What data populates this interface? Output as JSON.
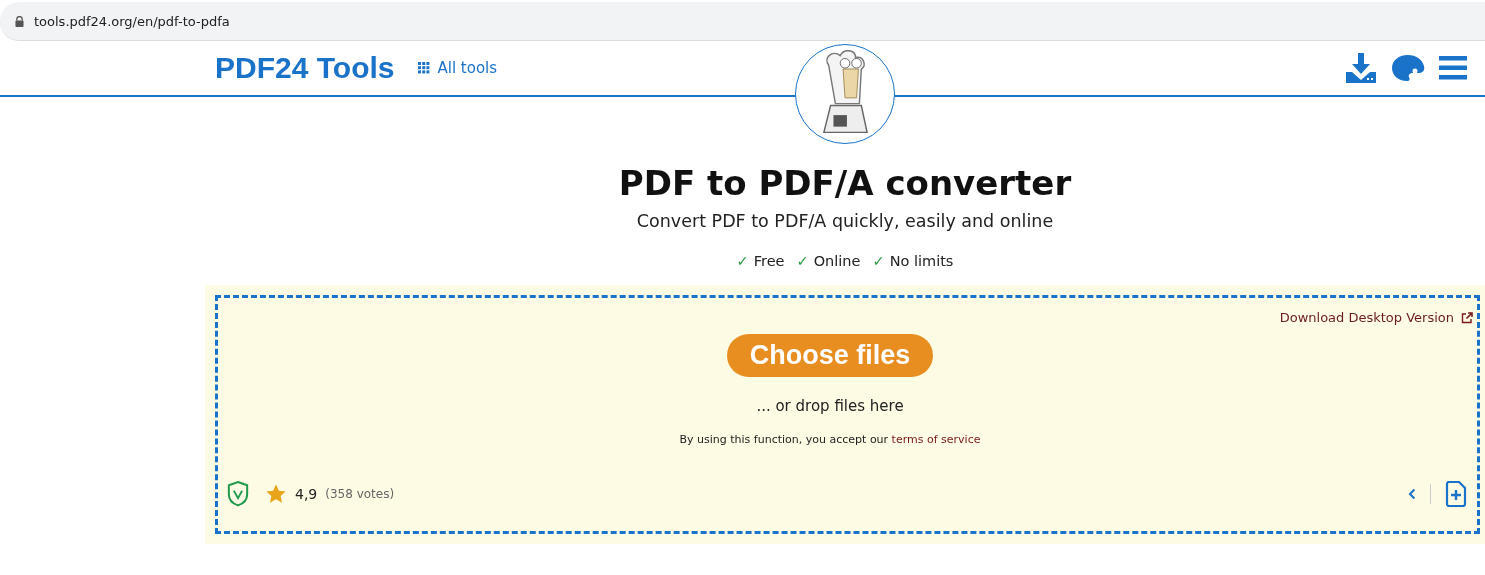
{
  "address_bar": {
    "url": "tools.pdf24.org/en/pdf-to-pdfa"
  },
  "header": {
    "logo": "PDF24 Tools",
    "all_tools": "All tools"
  },
  "title": "PDF to PDF/A converter",
  "subtitle": "Convert PDF to PDF/A quickly, easily and online",
  "features": [
    {
      "check": "✓",
      "label": "Free"
    },
    {
      "check": "✓",
      "label": "Online"
    },
    {
      "check": "✓",
      "label": "No limits"
    }
  ],
  "dropzone": {
    "desktop_link": "Download Desktop Version",
    "button": "Choose files",
    "drop_hint": "... or drop files here",
    "terms_prefix": "By using this function, you accept our",
    "terms_link": "terms of service",
    "rating": "4,9",
    "votes": "(358 votes)"
  }
}
